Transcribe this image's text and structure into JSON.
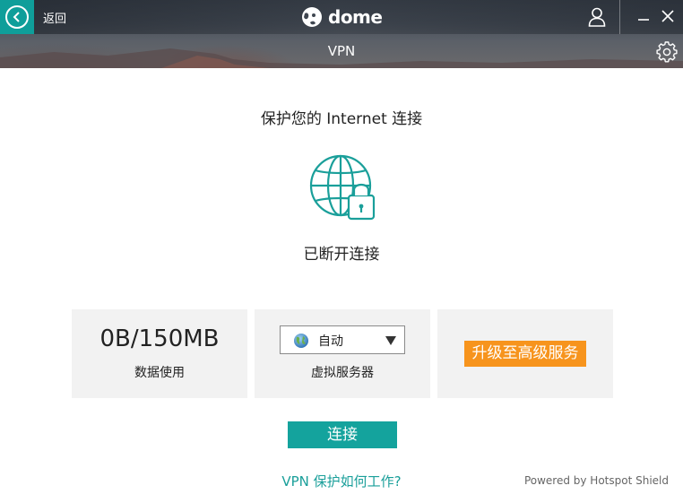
{
  "header": {
    "back_label": "返回",
    "brand_name": "dome",
    "window_title": "VPN"
  },
  "main": {
    "heading": "保护您的 Internet 连接",
    "status": "已断开连接",
    "usage": {
      "value": "0B/150MB",
      "label": "数据使用"
    },
    "server": {
      "selected": "自动",
      "label": "虚拟服务器"
    },
    "upgrade_label": "升级至高级服务",
    "connect_label": "连接",
    "how_it_works": "VPN 保护如何工作?",
    "powered_by": "Powered by Hotspot Shield"
  },
  "colors": {
    "accent": "#14a39d",
    "upgrade": "#f7941d",
    "panel_bg": "#f2f2f2"
  },
  "icons": {
    "back": "chevron-left-circle-icon",
    "brand": "panda-logo-icon",
    "user": "user-icon",
    "minimize": "minimize-icon",
    "close": "close-icon",
    "settings": "gear-icon",
    "status": "globe-lock-icon",
    "server": "globe-icon",
    "dropdown": "caret-down-icon"
  }
}
